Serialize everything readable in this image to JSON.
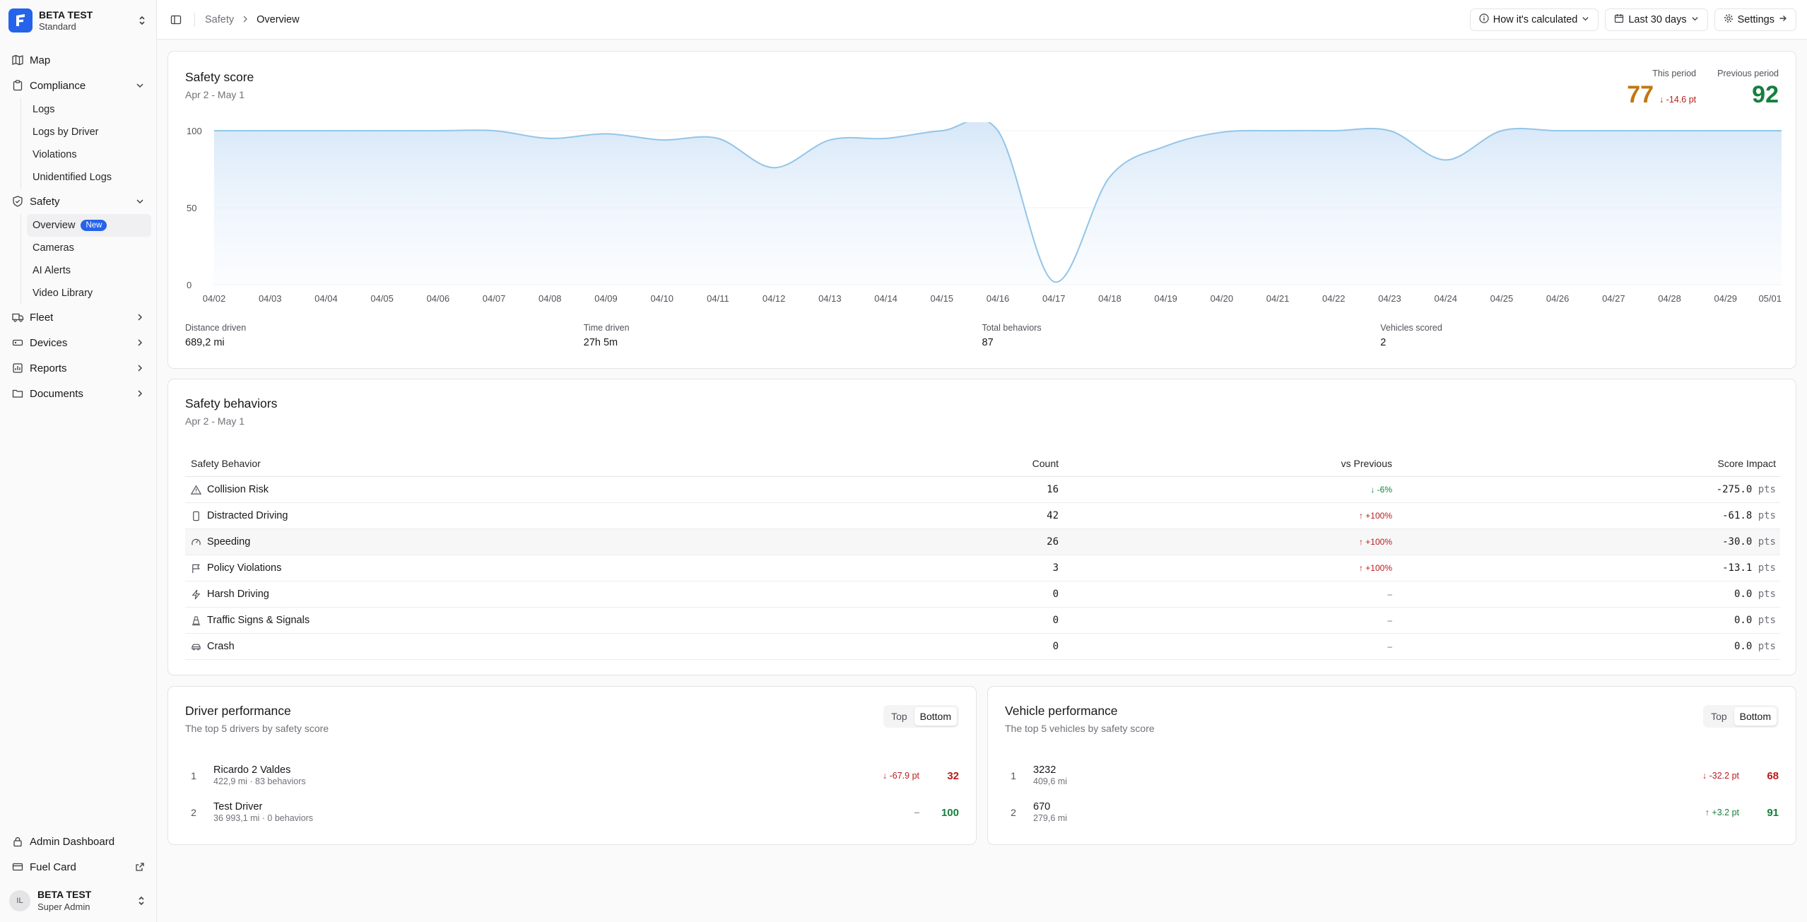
{
  "org": {
    "name": "BETA TEST",
    "plan": "Standard"
  },
  "nav": {
    "map": "Map",
    "compliance": "Compliance",
    "compliance_items": [
      "Logs",
      "Logs by Driver",
      "Violations",
      "Unidentified Logs"
    ],
    "safety": "Safety",
    "safety_overview": "Overview",
    "new_badge": "New",
    "safety_items": [
      "Cameras",
      "AI Alerts",
      "Video Library"
    ],
    "fleet": "Fleet",
    "devices": "Devices",
    "reports": "Reports",
    "documents": "Documents",
    "admin_dashboard": "Admin Dashboard",
    "fuel_card": "Fuel Card"
  },
  "user": {
    "initials": "IL",
    "name": "BETA TEST",
    "role": "Super Admin"
  },
  "breadcrumb": {
    "section": "Safety",
    "page": "Overview"
  },
  "toolbar": {
    "how_calculated": "How it's calculated",
    "range": "Last 30 days",
    "settings": "Settings"
  },
  "score": {
    "title": "Safety score",
    "range": "Apr 2 - May 1",
    "this_period_label": "This period",
    "this_period_value": "77",
    "delta": "-14.6 pt",
    "previous_label": "Previous period",
    "previous_value": "92"
  },
  "chart_data": {
    "type": "area",
    "x": [
      "04/02",
      "04/03",
      "04/04",
      "04/05",
      "04/06",
      "04/07",
      "04/08",
      "04/09",
      "04/10",
      "04/11",
      "04/12",
      "04/13",
      "04/14",
      "04/15",
      "04/16",
      "04/17",
      "04/18",
      "04/19",
      "04/20",
      "04/21",
      "04/22",
      "04/23",
      "04/24",
      "04/25",
      "04/26",
      "04/27",
      "04/28",
      "04/29",
      "05/01"
    ],
    "values": [
      100,
      100,
      100,
      100,
      100,
      100,
      95,
      98,
      94,
      95,
      76,
      94,
      95,
      100,
      100,
      2,
      70,
      90,
      99,
      100,
      100,
      100,
      81,
      100,
      100,
      100,
      100,
      100,
      100
    ],
    "yticks": [
      0,
      50,
      100
    ],
    "ylim": [
      0,
      100
    ],
    "color": "#93c5e8",
    "grid": true
  },
  "stats": [
    {
      "label": "Distance driven",
      "value": "689,2 mi"
    },
    {
      "label": "Time driven",
      "value": "27h 5m"
    },
    {
      "label": "Total behaviors",
      "value": "87"
    },
    {
      "label": "Vehicles scored",
      "value": "2"
    }
  ],
  "behaviors": {
    "title": "Safety behaviors",
    "range": "Apr 2 - May 1",
    "headers": [
      "Safety Behavior",
      "Count",
      "vs Previous",
      "Score Impact"
    ],
    "rows": [
      {
        "name": "Collision Risk",
        "icon": "warning-icon",
        "count": "16",
        "vs": "-6%",
        "dir": "down",
        "impact": "-275.0",
        "unit": "pts"
      },
      {
        "name": "Distracted Driving",
        "icon": "phone-icon",
        "count": "42",
        "vs": "+100%",
        "dir": "up",
        "impact": "-61.8",
        "unit": "pts"
      },
      {
        "name": "Speeding",
        "icon": "gauge-icon",
        "count": "26",
        "vs": "+100%",
        "dir": "up",
        "impact": "-30.0",
        "unit": "pts"
      },
      {
        "name": "Policy Violations",
        "icon": "flag-icon",
        "count": "3",
        "vs": "+100%",
        "dir": "up",
        "impact": "-13.1",
        "unit": "pts"
      },
      {
        "name": "Harsh Driving",
        "icon": "bolt-icon",
        "count": "0",
        "vs": "–",
        "dir": "none",
        "impact": "0.0",
        "unit": "pts"
      },
      {
        "name": "Traffic Signs & Signals",
        "icon": "cone-icon",
        "count": "0",
        "vs": "–",
        "dir": "none",
        "impact": "0.0",
        "unit": "pts"
      },
      {
        "name": "Crash",
        "icon": "car-icon",
        "count": "0",
        "vs": "–",
        "dir": "none",
        "impact": "0.0",
        "unit": "pts"
      }
    ]
  },
  "drivers": {
    "title": "Driver performance",
    "subtitle": "The top 5 drivers by safety score",
    "toggle": [
      "Top",
      "Bottom"
    ],
    "rows": [
      {
        "rank": "1",
        "name": "Ricardo 2 Valdes",
        "meta": "422,9 mi · 83 behaviors",
        "delta": "-67.9 pt",
        "dir": "down",
        "score": "32",
        "score_color": "red"
      },
      {
        "rank": "2",
        "name": "Test Driver",
        "meta": "36 993,1 mi · 0 behaviors",
        "delta": "–",
        "dir": "none",
        "score": "100",
        "score_color": "green"
      }
    ]
  },
  "vehicles": {
    "title": "Vehicle performance",
    "subtitle": "The top 5 vehicles by safety score",
    "toggle": [
      "Top",
      "Bottom"
    ],
    "rows": [
      {
        "rank": "1",
        "name": "3232",
        "meta": "409,6 mi",
        "delta": "-32.2 pt",
        "dir": "down",
        "score": "68",
        "score_color": "red"
      },
      {
        "rank": "2",
        "name": "670",
        "meta": "279,6 mi",
        "delta": "+3.2 pt",
        "dir": "up",
        "score": "91",
        "score_color": "green"
      }
    ]
  }
}
